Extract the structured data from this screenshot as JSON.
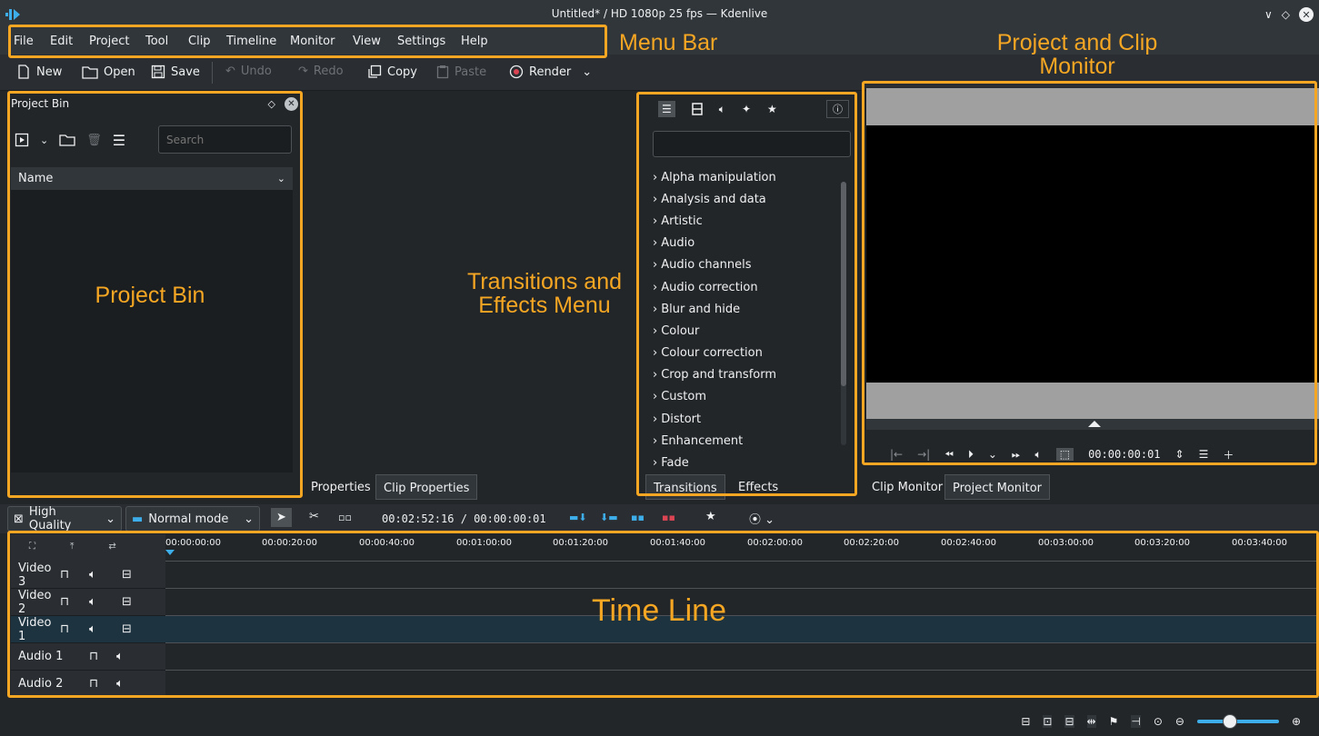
{
  "window": {
    "title": "Untitled* / HD 1080p 25 fps — Kdenlive"
  },
  "menu": [
    "File",
    "Edit",
    "Project",
    "Tool",
    "Clip",
    "Timeline",
    "Monitor",
    "View",
    "Settings",
    "Help"
  ],
  "toolbar": {
    "new": "New",
    "open": "Open",
    "save": "Save",
    "undo": "Undo",
    "redo": "Redo",
    "copy": "Copy",
    "paste": "Paste",
    "render": "Render"
  },
  "annotations": {
    "menu_bar": "Menu Bar",
    "monitor_line1": "Project and Clip",
    "monitor_line2": "Monitor",
    "bin": "Project Bin",
    "fx_line1": "Transitions and",
    "fx_line2": "Effects Menu",
    "timeline": "Time Line",
    "color": "#f5a623"
  },
  "bin": {
    "title": "Project Bin",
    "search_placeholder": "Search",
    "column_name": "Name"
  },
  "center_tabs": [
    "Properties",
    "Clip Properties"
  ],
  "effects": {
    "categories": [
      "Alpha manipulation",
      "Analysis and data",
      "Artistic",
      "Audio",
      "Audio channels",
      "Audio correction",
      "Blur and hide",
      "Colour",
      "Colour correction",
      "Crop and transform",
      "Custom",
      "Distort",
      "Enhancement",
      "Fade"
    ],
    "tabs": [
      "Transitions",
      "Effects"
    ]
  },
  "monitor": {
    "timecode": "00:00:00:01",
    "tabs": [
      "Clip Monitor",
      "Project Monitor"
    ]
  },
  "timeline_toolbar": {
    "quality": "High Quality",
    "mode": "Normal mode",
    "timecode": "00:02:52:16 / 00:00:00:01"
  },
  "ruler": [
    "00:00:00:00",
    "00:00:20:00",
    "00:00:40:00",
    "00:01:00:00",
    "00:01:20:00",
    "00:01:40:00",
    "00:02:00:00",
    "00:02:20:00",
    "00:02:40:00",
    "00:03:00:00",
    "00:03:20:00",
    "00:03:40:00"
  ],
  "tracks": [
    {
      "name": "Video 3",
      "type": "video"
    },
    {
      "name": "Video 2",
      "type": "video"
    },
    {
      "name": "Video 1",
      "type": "video",
      "selected": true
    },
    {
      "name": "Audio 1",
      "type": "audio"
    },
    {
      "name": "Audio 2",
      "type": "audio"
    }
  ],
  "colors": {
    "accent": "#3daee9",
    "window_bg": "#232629",
    "panel_bg": "#31363b",
    "selected_track": "#1d3340"
  }
}
